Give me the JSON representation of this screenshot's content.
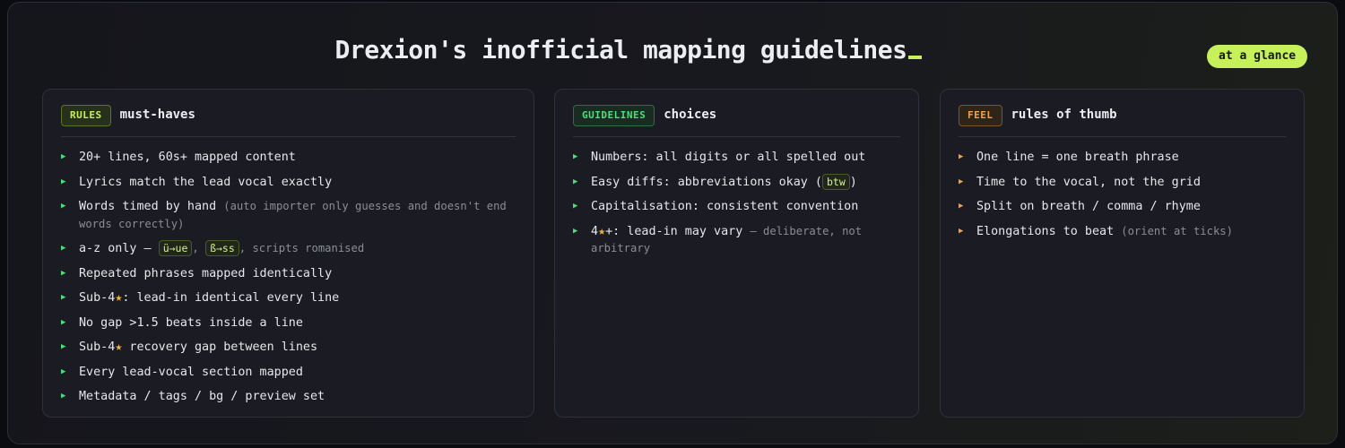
{
  "title": "Drexion's inofficial mapping guidelines",
  "badge": "at a glance",
  "colors": {
    "accent": "#c6f15a",
    "green": "#4ede7d",
    "orange": "#f0a347",
    "star": "#f2b43a"
  },
  "icons": {
    "bullet": "triangle-right-icon",
    "star": "star-icon"
  },
  "rules": {
    "tag": "RULES",
    "subtitle": "must-haves",
    "items": [
      "20+ lines, 60s+ mapped content",
      "Lyrics match the lead vocal exactly",
      {
        "text": "Words timed by hand",
        "note": "(auto importer only guesses and doesn't end words correctly)"
      },
      {
        "before": "a-z only — ",
        "chip1": "ü→ue",
        "between": ", ",
        "chip2": "ß→ss",
        "after": ", scripts romanised"
      },
      "Repeated phrases mapped identically",
      {
        "pre": "Sub-4",
        "star": "★",
        "post": ": lead-in identical every line"
      },
      "No gap >1.5 beats inside a line",
      {
        "pre": "Sub-4",
        "star": "★",
        "post": " recovery gap between lines"
      },
      "Every lead-vocal section mapped",
      "Metadata / tags / bg / preview set"
    ]
  },
  "guidelines": {
    "tag": "GUIDELINES",
    "subtitle": "choices",
    "items": [
      "Numbers: all digits or all spelled out",
      {
        "before": "Easy diffs: abbreviations okay (",
        "chip": "btw",
        "after": ")"
      },
      "Capitalisation: consistent convention",
      {
        "pre": "4",
        "star": "★",
        "post": "+: lead-in may vary",
        "note": "— deliberate, not arbitrary"
      }
    ]
  },
  "feel": {
    "tag": "FEEL",
    "subtitle": "rules of thumb",
    "items": [
      "One line = one breath phrase",
      "Time to the vocal, not the grid",
      "Split on breath / comma / rhyme",
      {
        "text": "Elongations to beat",
        "note": "(orient at ticks)"
      }
    ]
  }
}
